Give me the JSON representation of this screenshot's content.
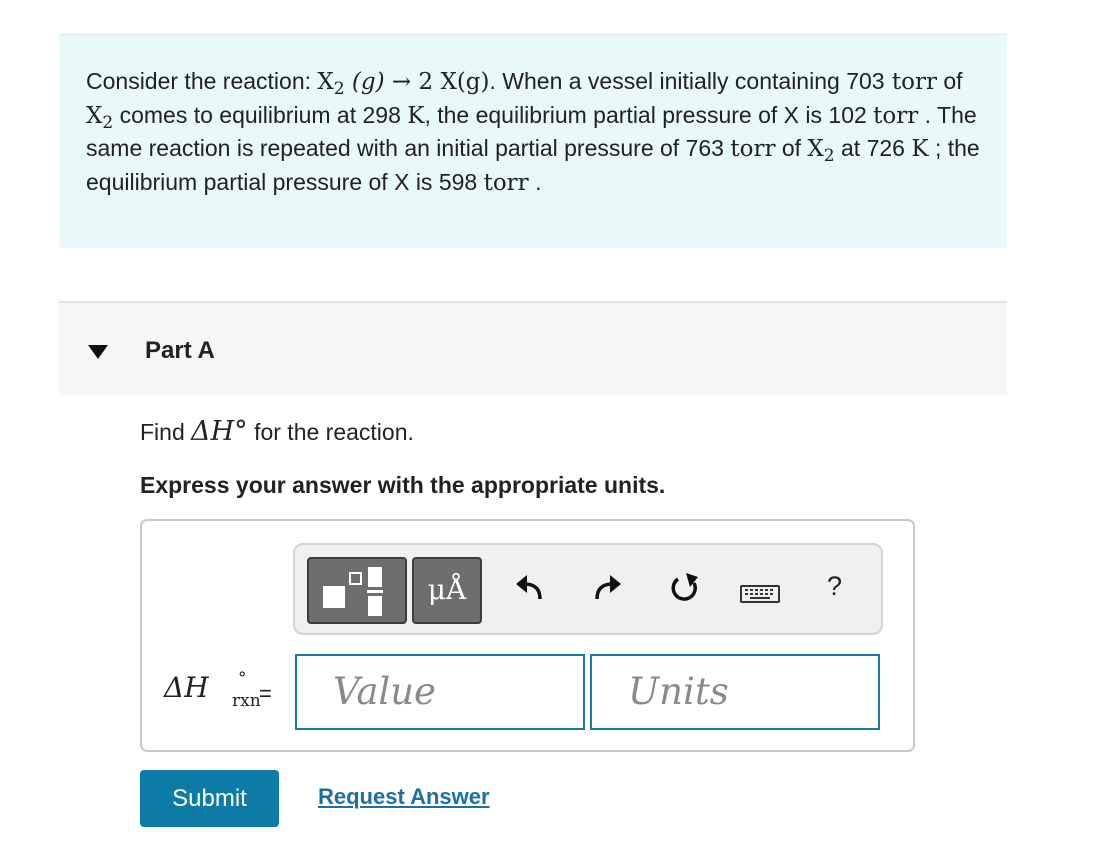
{
  "problem": {
    "intro": "Consider the reaction: ",
    "reaction_lhs_base": "X",
    "reaction_lhs_sub": "2",
    "reaction_lhs_phase": "(g)",
    "reaction_arrow": "→",
    "reaction_rhs": "2 X(g)",
    "seg1": ". When a vessel initially containing",
    "p1_value": "703",
    "torr_unit": "torr",
    "seg2": "of",
    "species_base": "X",
    "species_sub": "2",
    "seg3": "comes to equilibrium at",
    "t1_value": "298",
    "kelvin_unit": "K",
    "seg4": ", the equilibrium partial pressure of X is",
    "p2_value": "102",
    "seg5": ". The same reaction is repeated with an initial partial pressure of",
    "p3_value": "763",
    "seg6": "at",
    "t2_value": "726",
    "seg7": "; the equilibrium partial pressure of X is",
    "p4_value": "598",
    "period": "."
  },
  "part": {
    "label": "Part A",
    "expanded": true
  },
  "question": {
    "find_prefix": "Find",
    "find_symbol": "ΔH°",
    "find_suffix": "for the reaction.",
    "instruction": "Express your answer with the appropriate units."
  },
  "toolbar": {
    "units_glyph": "μÅ",
    "help_label": "?",
    "icons": [
      "templates-icon",
      "units-icon",
      "undo-icon",
      "redo-icon",
      "reset-icon",
      "keyboard-icon",
      "help-icon"
    ]
  },
  "answer": {
    "lhs_symbol": "ΔH",
    "lhs_superscript": "°",
    "lhs_subscript": "rxn",
    "equals": "=",
    "value_placeholder": "Value",
    "units_placeholder": "Units"
  },
  "actions": {
    "submit_label": "Submit",
    "request_label": "Request Answer"
  },
  "colors": {
    "problem_bg": "#e9f8f8",
    "part_bg": "#f6f6f6",
    "submit_bg": "#0d7ba6",
    "link": "#1d6fa5",
    "field_border": "#1a7aa0"
  }
}
